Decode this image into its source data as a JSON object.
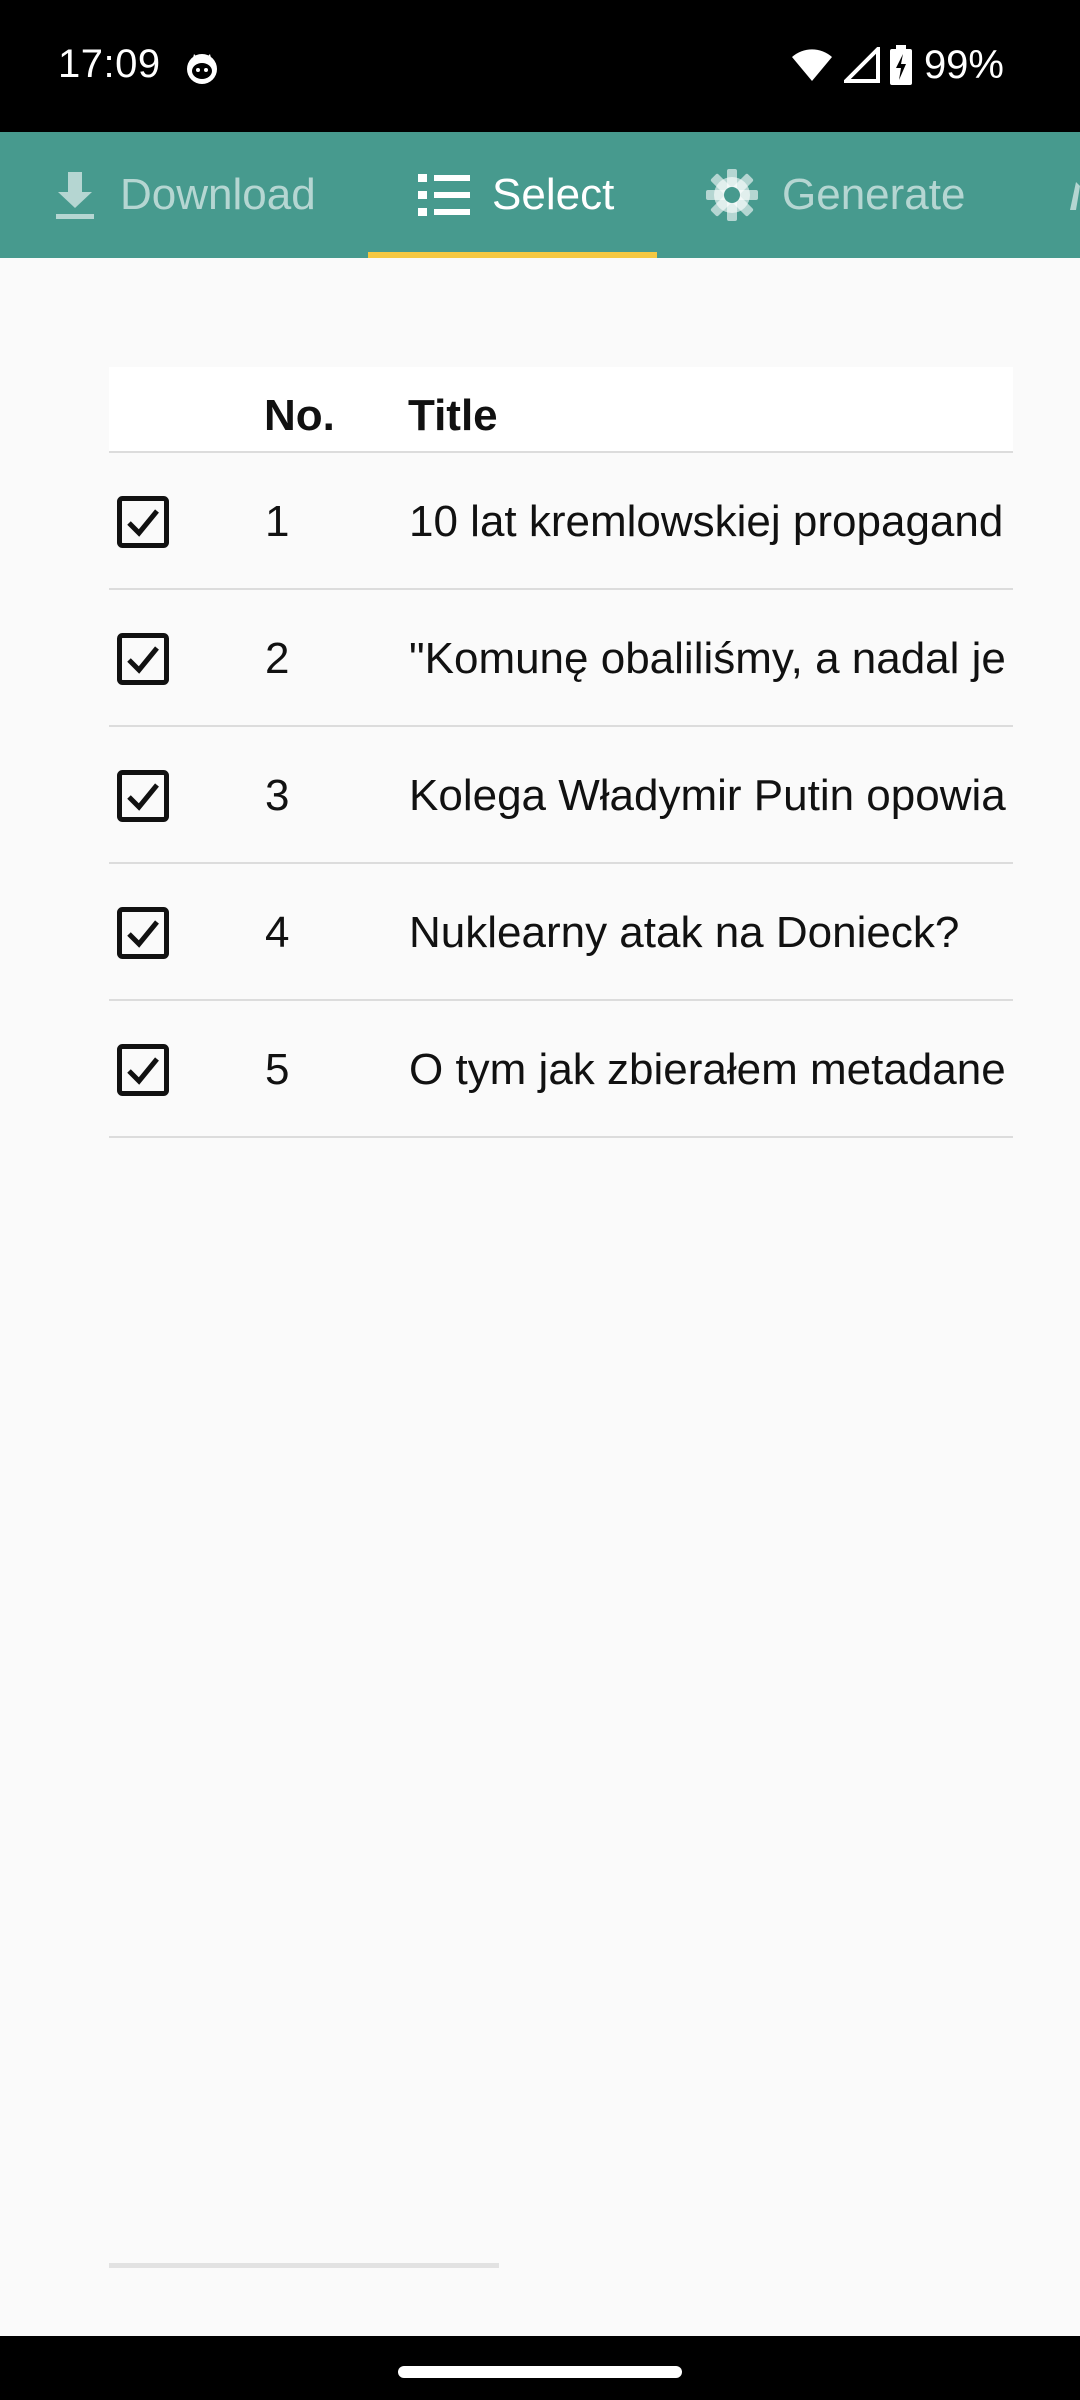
{
  "status_bar": {
    "time": "17:09",
    "notification_icon": "cat-face-icon",
    "wifi_icon": "wifi-icon",
    "signal_icon": "cell-signal-icon",
    "battery_icon": "battery-charging-icon",
    "battery_percent": "99%"
  },
  "tabs": [
    {
      "label": "Download",
      "icon": "download-icon",
      "active": false
    },
    {
      "label": "Select",
      "icon": "list-icon",
      "active": true
    },
    {
      "label": "Generate",
      "icon": "gear-icon",
      "active": false
    }
  ],
  "colors": {
    "tab_bar": "#479a8e",
    "tab_indicator": "#f5c842",
    "background": "#fafafa"
  },
  "table": {
    "headers": {
      "number": "No.",
      "title": "Title"
    },
    "rows": [
      {
        "checked": true,
        "number": "1",
        "title": "10 lat kremlowskiej propagand"
      },
      {
        "checked": true,
        "number": "2",
        "title": "\"Komunę obaliliśmy, a nadal je"
      },
      {
        "checked": true,
        "number": "3",
        "title": "Kolega Władymir Putin opowia"
      },
      {
        "checked": true,
        "number": "4",
        "title": "Nuklearny atak na Donieck?"
      },
      {
        "checked": true,
        "number": "5",
        "title": "O tym jak zbierałem metadane"
      }
    ]
  }
}
